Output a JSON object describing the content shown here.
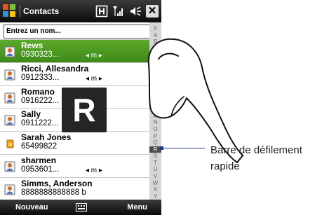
{
  "window": {
    "title": "Contacts"
  },
  "search": {
    "placeholder": "Entrez un nom..."
  },
  "contacts": [
    {
      "name": "Rews",
      "detail": "0930323...",
      "arrows": "◂ m ▸",
      "selected": true
    },
    {
      "name": "Ricci, Allesandra",
      "detail": "0912333...",
      "arrows": "◂ m ▸",
      "selected": false
    },
    {
      "name": "Romano",
      "detail": "0916222...",
      "arrows": "",
      "selected": false
    },
    {
      "name": "Sally",
      "detail": "0911222...",
      "arrows": "",
      "selected": false
    },
    {
      "name": "Sarah Jones",
      "detail": "65499822",
      "arrows": "",
      "selected": false
    },
    {
      "name": "sharmen",
      "detail": "0953601...",
      "arrows": "◂ m ▸",
      "selected": false
    },
    {
      "name": "Simms, Anderson",
      "detail": "8888888888888  b",
      "arrows": "",
      "selected": false
    }
  ],
  "alphabet": [
    "#",
    "A",
    "B",
    "C",
    "D",
    "E",
    "F",
    "G",
    "H",
    "I",
    "J",
    "K",
    "L",
    "M",
    "N",
    "O",
    "P",
    "Q",
    "R",
    "S",
    "T",
    "U",
    "V",
    "W",
    "X",
    "Y",
    "Z"
  ],
  "alphabet_active": "R",
  "big_letter": "R",
  "softkeys": {
    "left": "Nouveau",
    "right": "Menu"
  },
  "callout": {
    "line1": "Barre de défilement",
    "line2": "rapide"
  },
  "icons": {
    "start": "windows-flag-icon",
    "status": [
      "keyboard-h-icon",
      "signal-icon",
      "speaker-icon"
    ],
    "close": "close-icon",
    "keyboard": "keyboard-icon"
  },
  "colors": {
    "selected_row": "#4c9c22",
    "title_bar": "#1a1a1a",
    "callout_line": "#1f3a7a"
  }
}
